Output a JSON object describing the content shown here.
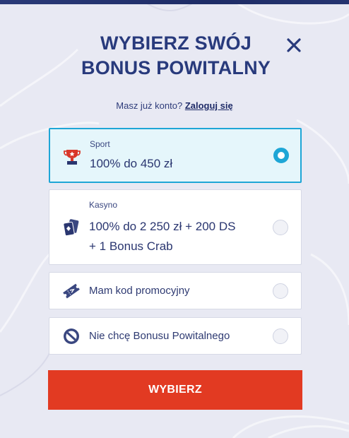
{
  "modal": {
    "title": "WYBIERZ SWÓJ BONUS POWITALNY",
    "close_icon": "close-icon"
  },
  "login": {
    "prompt": "Masz już konto?",
    "link": "Zaloguj się"
  },
  "options": [
    {
      "id": "sport",
      "icon": "trophy-icon",
      "category": "Sport",
      "label": "100% do 450 zł",
      "selected": true
    },
    {
      "id": "casino",
      "icon": "playing-cards-icon",
      "category": "Kasyno",
      "label_line1": "100% do 2 250 zł + 200 DS",
      "label_line2": "+ 1 Bonus Crab",
      "selected": false
    },
    {
      "id": "promo",
      "icon": "ticket-icon",
      "label": "Mam kod promocyjny",
      "selected": false
    },
    {
      "id": "none",
      "icon": "no-entry-icon",
      "label": "Nie chcę Bonusu Powitalnego",
      "selected": false
    }
  ],
  "submit": {
    "label": "WYBIERZ"
  },
  "colors": {
    "title": "#283a7c",
    "accent": "#1ea6d6",
    "cta": "#e23a22",
    "background": "#e8e9f3"
  }
}
